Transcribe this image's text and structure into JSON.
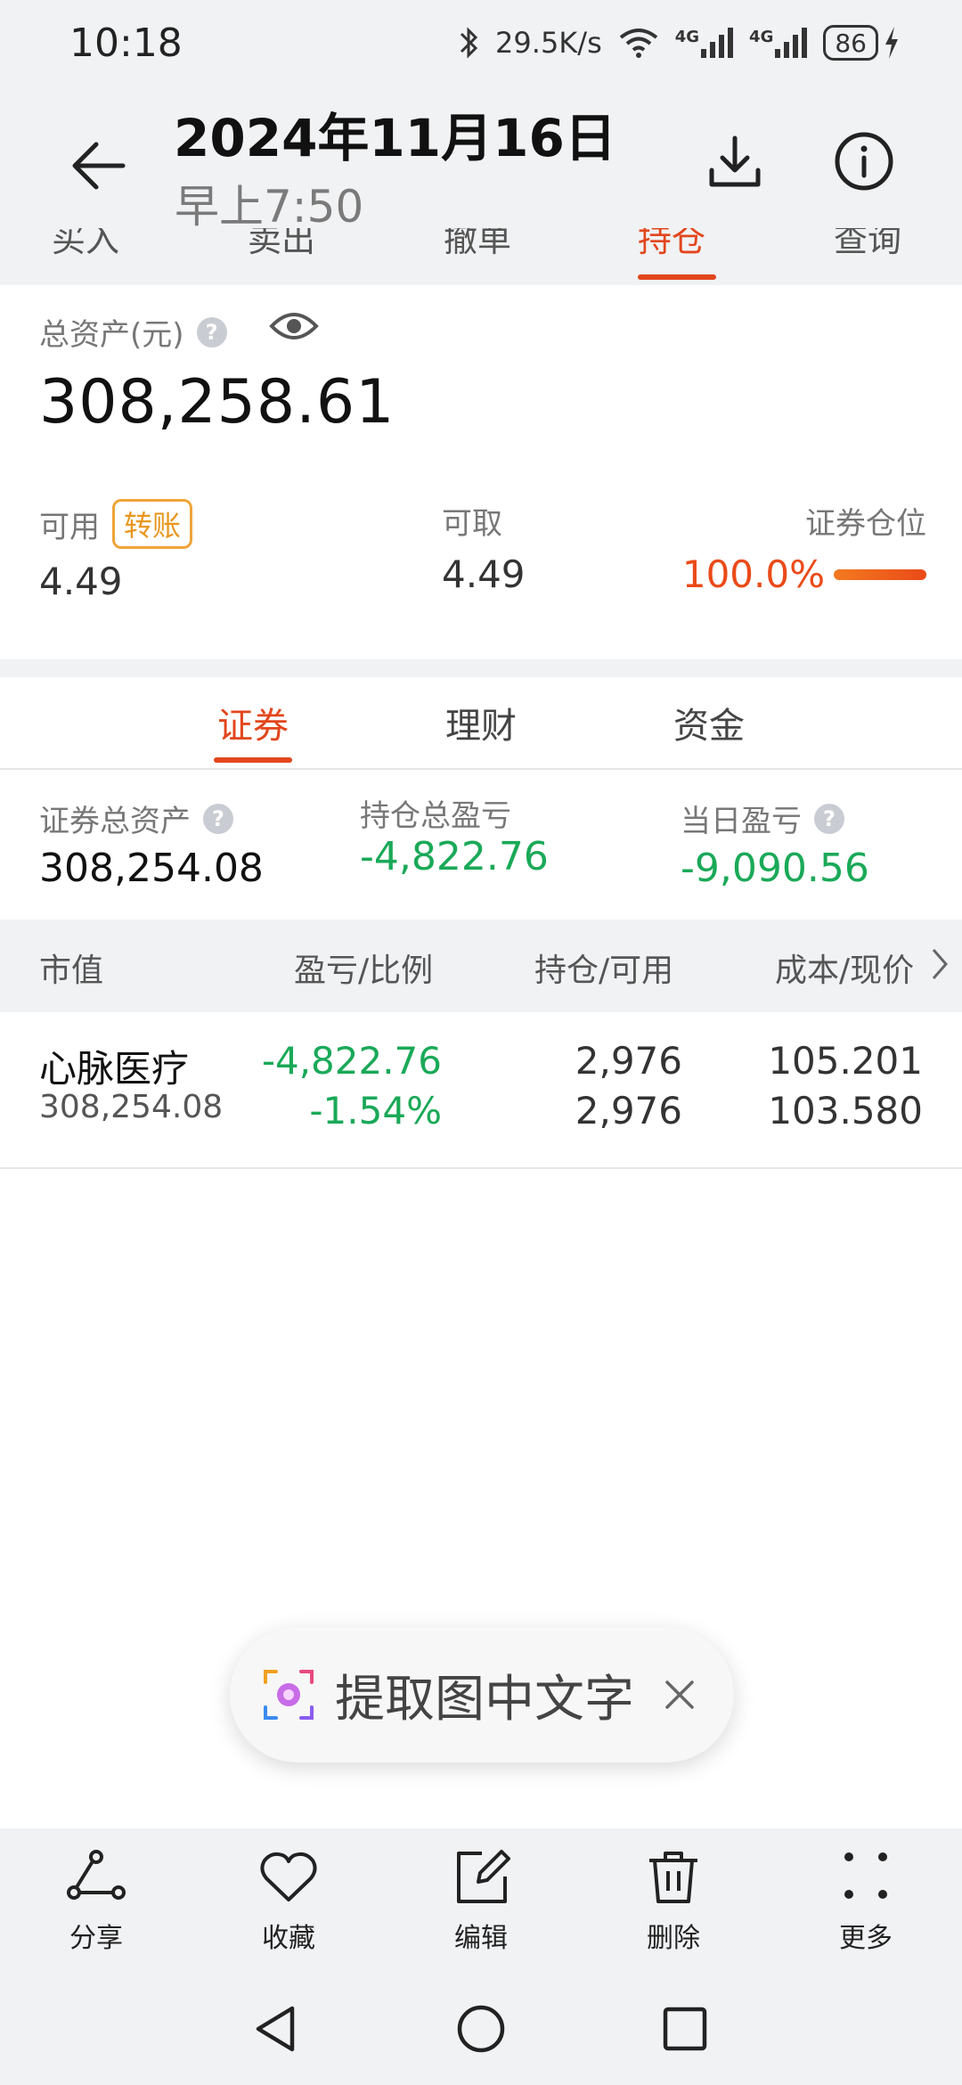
{
  "status_bar": {
    "time": "10:18",
    "net_speed": "29.5K/s",
    "signal1": "4G",
    "signal2": "4G",
    "battery": "86"
  },
  "viewer": {
    "date": "2024年11月16日",
    "time": "早上7:50"
  },
  "trade_tabs": [
    {
      "label": "买入"
    },
    {
      "label": "卖出"
    },
    {
      "label": "撤单"
    },
    {
      "label": "持仓"
    },
    {
      "label": "查询"
    }
  ],
  "account": {
    "total_label": "总资产(元)",
    "total_value": "308,258.61",
    "available_label": "可用",
    "transfer_label": "转账",
    "available_value": "4.49",
    "withdrawable_label": "可取",
    "withdrawable_value": "4.49",
    "position_label": "证券仓位",
    "position_value": "100.0%"
  },
  "category_tabs": [
    {
      "label": "证券"
    },
    {
      "label": "理财"
    },
    {
      "label": "资金"
    }
  ],
  "stats": {
    "sec_total_label": "证券总资产",
    "sec_total_value": "308,254.08",
    "hold_pl_label": "持仓总盈亏",
    "hold_pl_value": "-4,822.76",
    "day_pl_label": "当日盈亏",
    "day_pl_value": "-9,090.56"
  },
  "table": {
    "headers": [
      "市值",
      "盈亏/比例",
      "持仓/可用",
      "成本/现价"
    ],
    "rows": [
      {
        "name": "心脉医疗",
        "market_value": "308,254.08",
        "pl": "-4,822.76",
        "pl_pct": "-1.54%",
        "holding": "2,976",
        "available": "2,976",
        "cost": "105.201",
        "price": "103.580"
      }
    ]
  },
  "ocr_pill": {
    "label": "提取图中文字"
  },
  "actions": [
    {
      "label": "分享",
      "icon": "share-icon"
    },
    {
      "label": "收藏",
      "icon": "heart-icon"
    },
    {
      "label": "编辑",
      "icon": "edit-icon"
    },
    {
      "label": "删除",
      "icon": "trash-icon"
    },
    {
      "label": "更多",
      "icon": "more-icon"
    }
  ],
  "colors": {
    "accent": "#e2461c",
    "loss_green": "#1aa958",
    "transfer_orange": "#e8961d"
  }
}
